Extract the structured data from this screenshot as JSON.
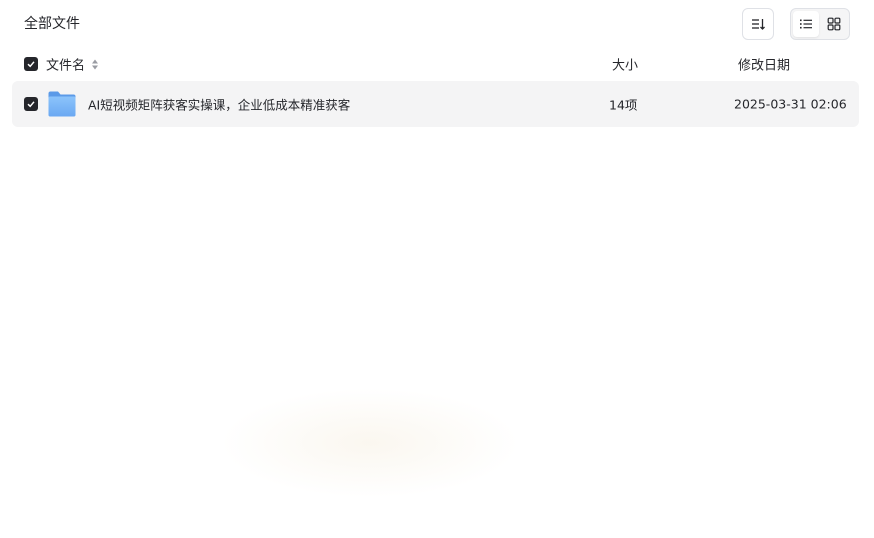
{
  "breadcrumb": {
    "label": "全部文件"
  },
  "toolbar": {
    "sort_icon": "sort-icon",
    "view_list_icon": "list-view-icon",
    "view_grid_icon": "grid-view-icon",
    "active_view": "list"
  },
  "table": {
    "columns": {
      "name": "文件名",
      "size": "大小",
      "date": "修改日期"
    },
    "rows": [
      {
        "icon": "folder-icon",
        "name": "AI短视频矩阵获客实操课，企业低成本精准获客",
        "size": "14项",
        "date": "2025-03-31 02:06",
        "checked": true
      }
    ]
  },
  "colors": {
    "text": "#25262b",
    "row_bg": "#f4f4f5",
    "folder": "#7cb6f6",
    "border": "#dfe1e6"
  }
}
